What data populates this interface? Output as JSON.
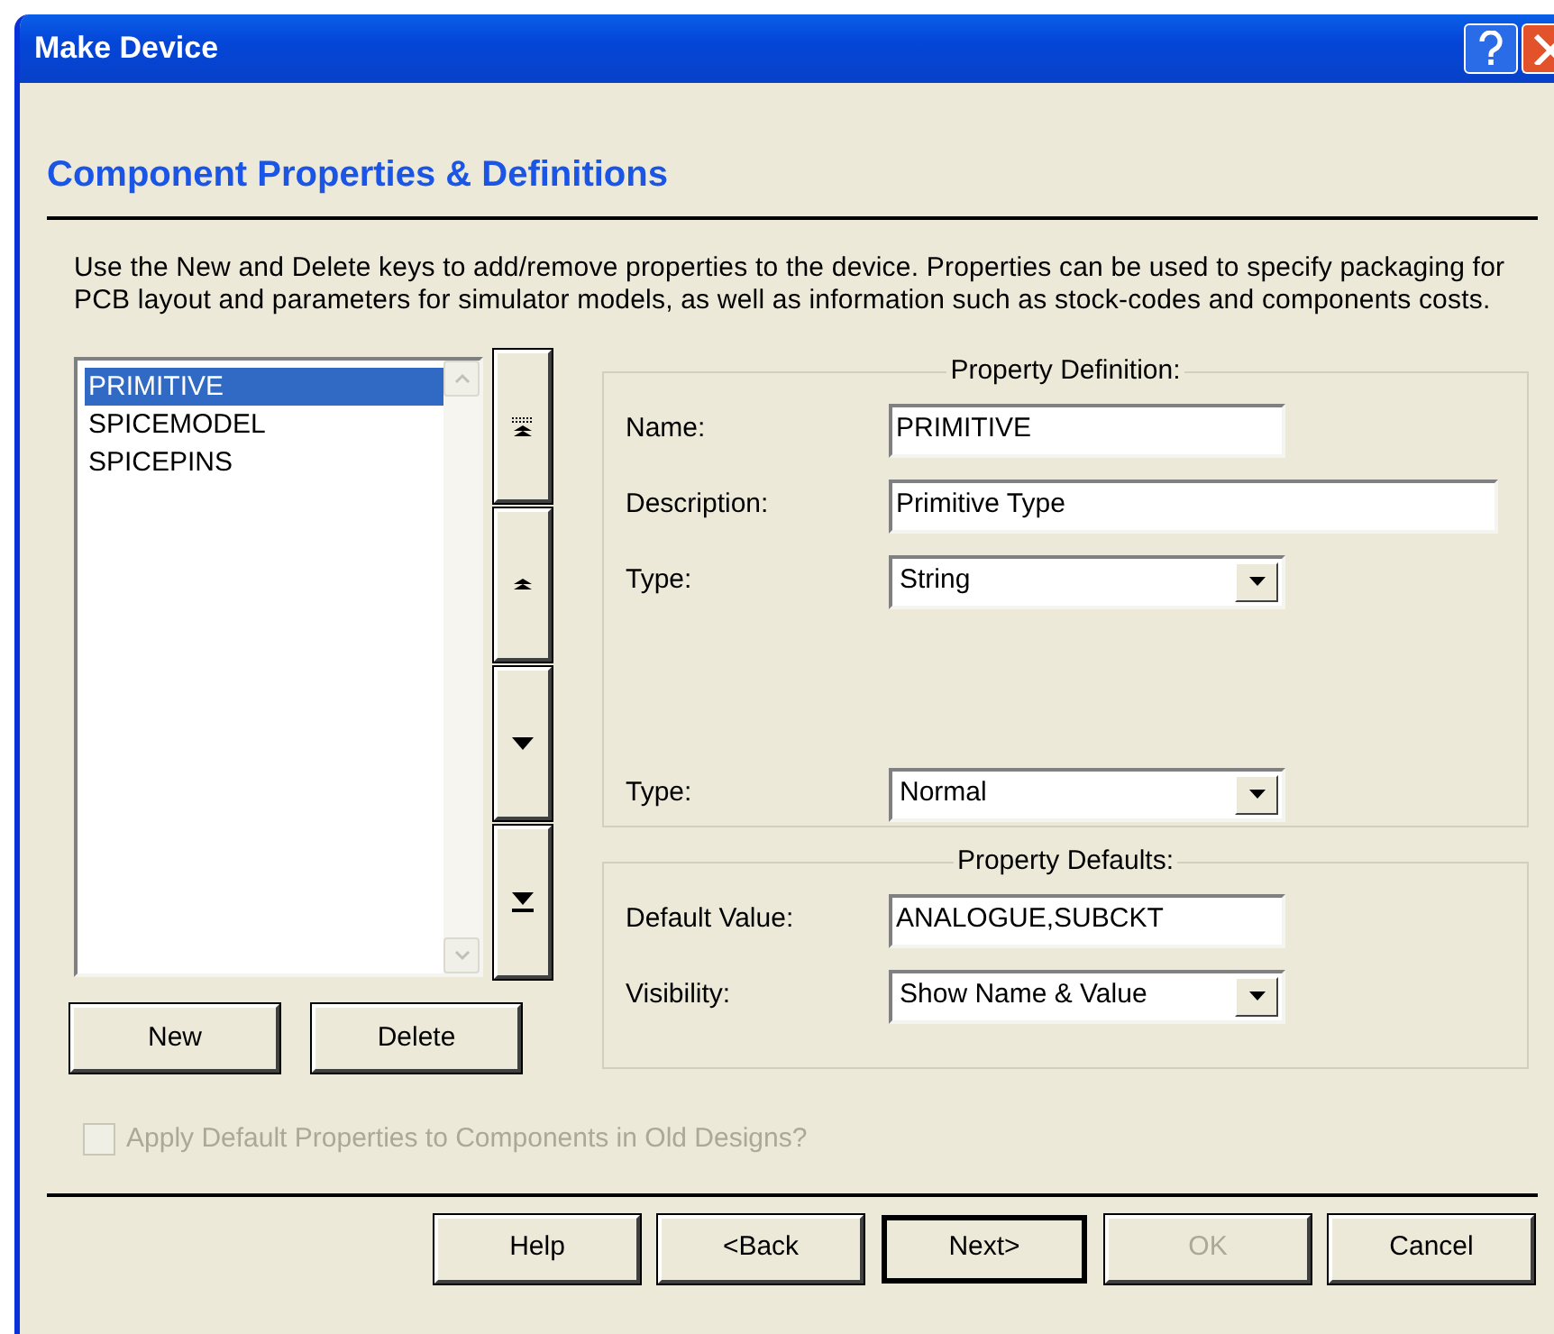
{
  "window": {
    "title": "Make Device"
  },
  "header": {
    "title": "Component Properties & Definitions"
  },
  "intro": "Use the New and Delete keys to add/remove properties to the device. Properties can be used to specify packaging for PCB layout and parameters for simulator models, as well as information such as stock-codes and components costs.",
  "properties": [
    {
      "label": "PRIMITIVE",
      "selected": true
    },
    {
      "label": "SPICEMODEL",
      "selected": false
    },
    {
      "label": "SPICEPINS",
      "selected": false
    }
  ],
  "list_buttons": [
    "New",
    "Delete"
  ],
  "property_definition": {
    "legend": "Property Definition:",
    "fields": [
      {
        "kind": "short",
        "label": "Name:",
        "value": "PRIMITIVE"
      },
      {
        "kind": "long",
        "label": "Description:",
        "value": "Primitive Type"
      },
      {
        "kind": "dropdown",
        "label": "Type:",
        "value": "String"
      }
    ],
    "lower_fields": [
      {
        "kind": "dropdown",
        "label": "Type:",
        "value": "Normal"
      }
    ]
  },
  "property_defaults": {
    "legend": "Property Defaults:",
    "fields": [
      {
        "kind": "short",
        "label": "Default Value:",
        "value": "ANALOGUE,SUBCKT"
      },
      {
        "kind": "dropdown",
        "label": "Visibility:",
        "value": "Show Name & Value"
      }
    ]
  },
  "apply_checkbox": {
    "label": "Apply Default Properties to Components in Old Designs?",
    "checked": false,
    "disabled": true
  },
  "buttons": [
    {
      "label": "Help",
      "disabled": false,
      "default": false
    },
    {
      "label": "<Back",
      "disabled": false,
      "default": false
    },
    {
      "label": "Next>",
      "disabled": false,
      "default": true
    },
    {
      "label": "OK",
      "disabled": true,
      "default": false
    },
    {
      "label": "Cancel",
      "disabled": false,
      "default": false
    }
  ]
}
